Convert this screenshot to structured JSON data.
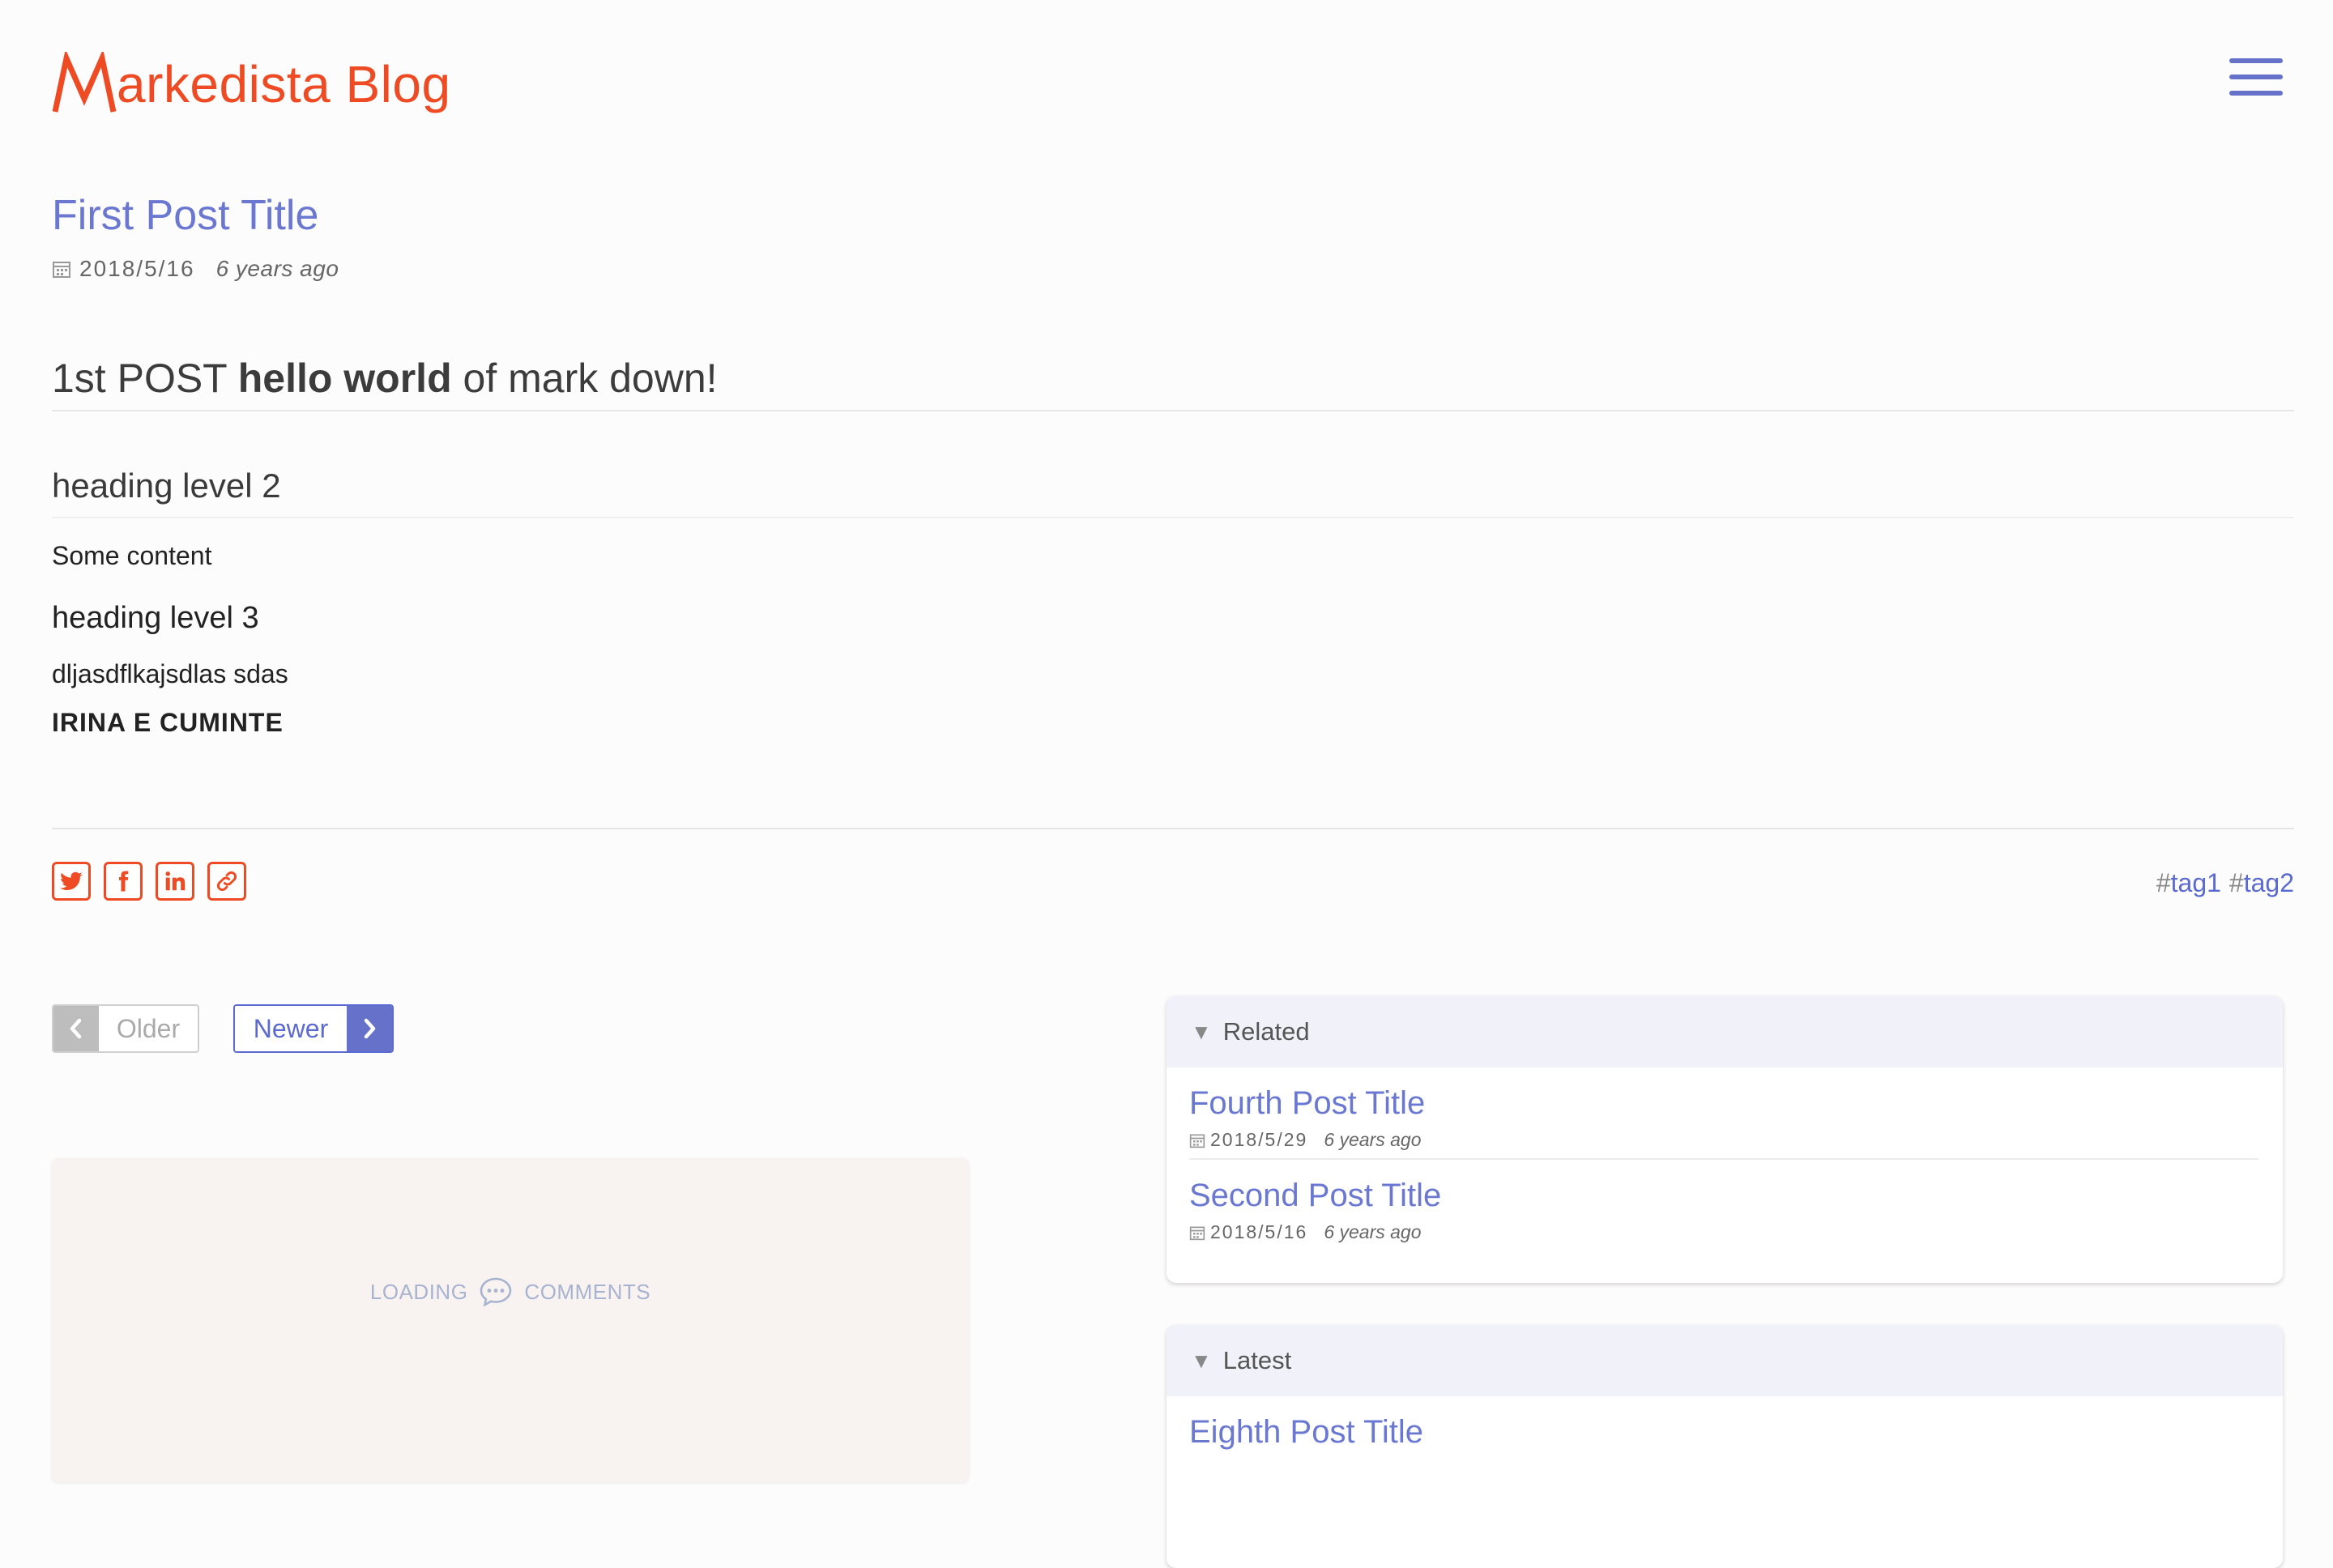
{
  "header": {
    "logo_text": "arkedista Blog",
    "brand_color": "#ee4b24",
    "menu_icon": "hamburger-menu-icon"
  },
  "post": {
    "title": "First Post Title",
    "date": "2018/5/16",
    "ago": "6 years ago"
  },
  "content": {
    "h1_pre": "1st POST ",
    "h1_bold": "hello world",
    "h1_post": " of mark down!",
    "h2": "heading level 2",
    "p1": "Some content",
    "h3": "heading level 3",
    "p2": "dljasdflkajsdlas sdas",
    "p3": "IRINA E CUMINTE"
  },
  "share": {
    "icons": [
      "twitter-icon",
      "facebook-icon",
      "linkedin-icon",
      "link-icon"
    ]
  },
  "tags": [
    {
      "hash": "#",
      "label": "tag1"
    },
    {
      "hash": "#",
      "label": "tag2"
    }
  ],
  "pagination": {
    "older": "Older",
    "newer": "Newer"
  },
  "comments": {
    "left": "LOADING",
    "right": "COMMENTS"
  },
  "related": {
    "heading": "Related",
    "items": [
      {
        "title": "Fourth Post Title",
        "date": "2018/5/29",
        "ago": "6 years ago"
      },
      {
        "title": "Second Post Title",
        "date": "2018/5/16",
        "ago": "6 years ago"
      }
    ]
  },
  "latest": {
    "heading": "Latest",
    "items": [
      {
        "title": "Eighth Post Title"
      }
    ]
  },
  "colors": {
    "link": "#6a78d1",
    "accent": "#ee4b24",
    "primary": "#5b6ad0"
  }
}
